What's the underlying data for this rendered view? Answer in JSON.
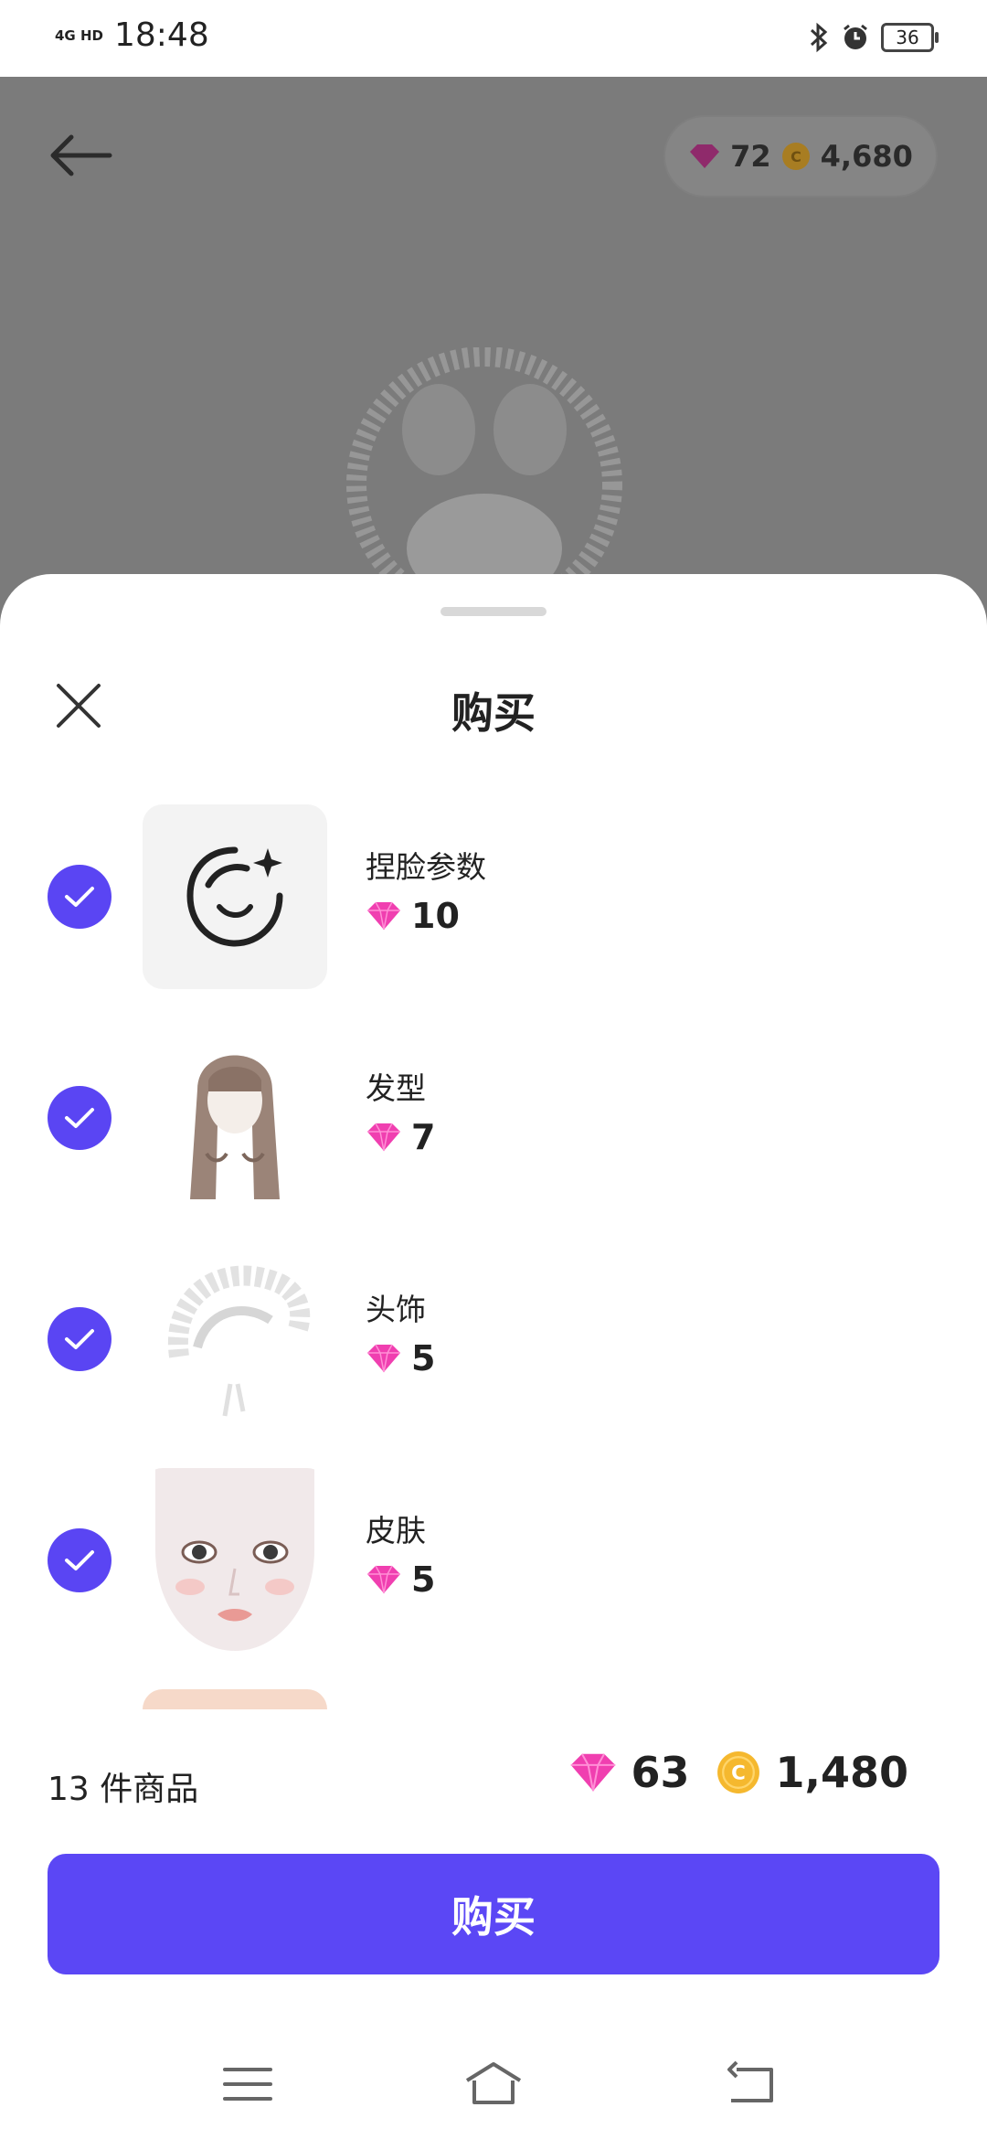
{
  "status_bar": {
    "network": "4G HD",
    "time": "18:48",
    "battery": "36"
  },
  "header": {
    "gems": "72",
    "coins": "4,680"
  },
  "sheet": {
    "title": "购买",
    "items": [
      {
        "name": "捏脸参数",
        "price": "10",
        "icon": "face-sparkle-icon"
      },
      {
        "name": "发型",
        "price": "7",
        "icon": "hairstyle-image"
      },
      {
        "name": "头饰",
        "price": "5",
        "icon": "headdress-image"
      },
      {
        "name": "皮肤",
        "price": "5",
        "icon": "skin-face-image"
      }
    ]
  },
  "footer": {
    "count_label": "13 件商品",
    "total_gems": "63",
    "total_coins": "1,480",
    "buy_label": "购买"
  },
  "colors": {
    "accent": "#5b47f5",
    "gem": "#f03fb0",
    "coin": "#f5b82e"
  }
}
